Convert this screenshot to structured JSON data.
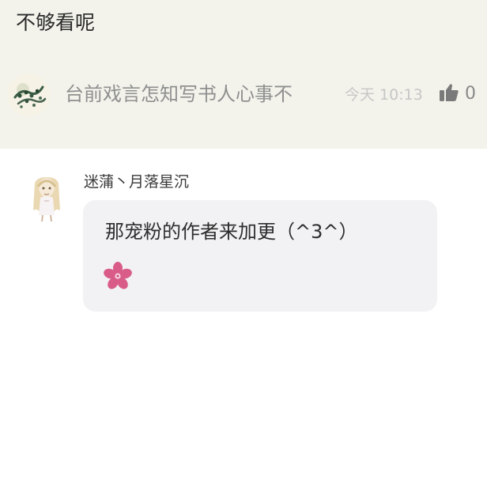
{
  "post": {
    "title": "不够看呢"
  },
  "comment": {
    "author_avatar_icon": "leaf-avatar-icon",
    "text": "台前戏言怎知写书人心事不",
    "time": "今天 10:13",
    "like_icon": "thumbs-up-icon",
    "like_count": "0"
  },
  "reply": {
    "author_avatar_icon": "anime-girl-avatar-icon",
    "author_name": "迷蒲丶月落星沉",
    "text": "那宠粉的作者来加更（^3^）",
    "emoji_icon": "flower-icon"
  },
  "colors": {
    "top_background": "#f3f3ec",
    "bubble_background": "#f2f1f3",
    "flower": "#d95c88"
  }
}
